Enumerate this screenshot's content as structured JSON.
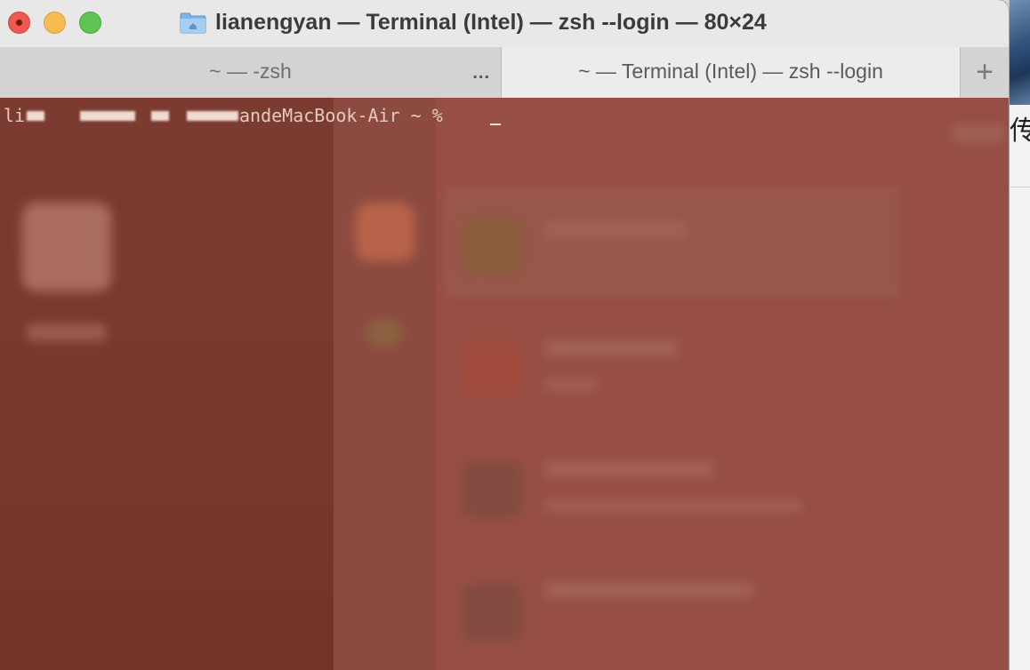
{
  "window": {
    "title": "lianengyan — Terminal (Intel) — zsh --login — 80×24",
    "title_icon": "folder-icon"
  },
  "traffic_lights": {
    "close": "close-icon",
    "minimize": "minimize-icon",
    "maximize": "maximize-icon",
    "colors": {
      "close": "#ee5a52",
      "minimize": "#f5bd4f",
      "maximize": "#5fc453"
    }
  },
  "tabs": [
    {
      "label": "~ — -zsh",
      "active": false,
      "overflow": "..."
    },
    {
      "label": "~ — Terminal (Intel) — zsh --login",
      "active": true
    }
  ],
  "new_tab": {
    "glyph": "+"
  },
  "terminal": {
    "prompt_prefix": "li",
    "prompt_host": "andeMacBook-Air ~ % ",
    "background_color": "#974f45",
    "text_color": "#e4c9c0"
  },
  "background_app": {
    "char": "传"
  }
}
